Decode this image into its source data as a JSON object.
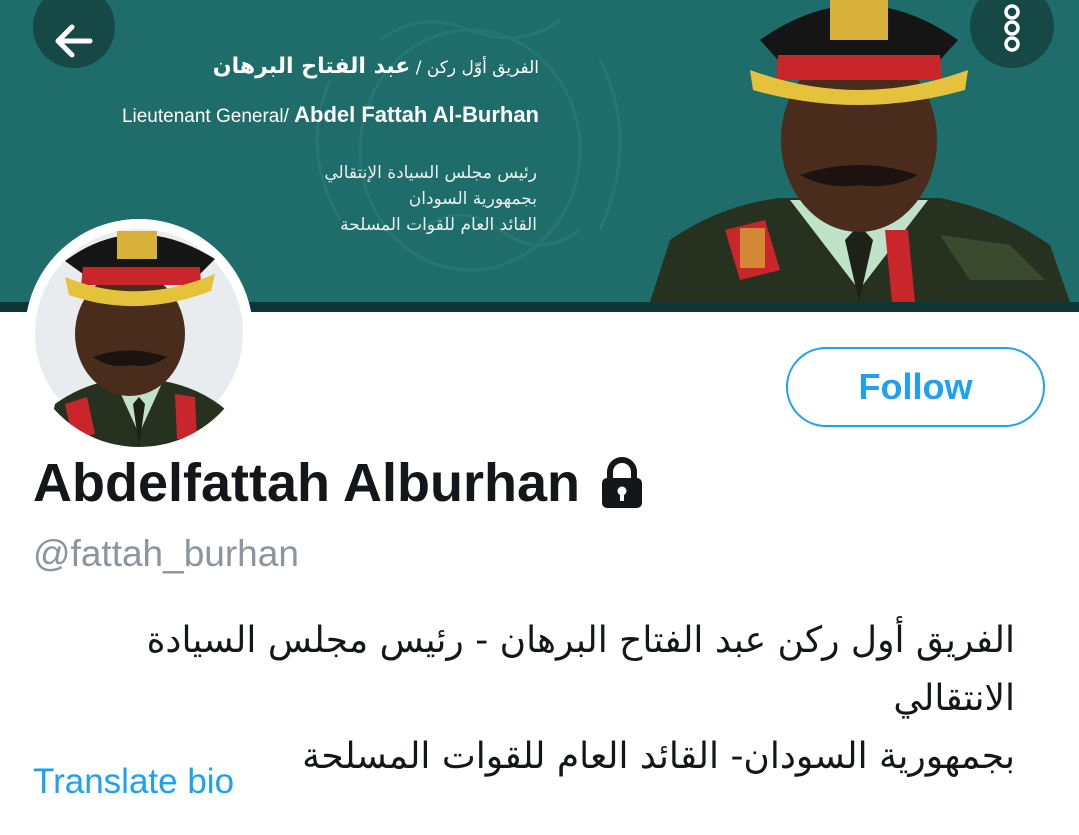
{
  "header": {
    "back_icon": "arrow-left-icon",
    "more_icon": "vertical-dots-icon",
    "colors": {
      "banner": "#1e6d6b",
      "strip": "#0f3535"
    }
  },
  "banner": {
    "ar_title_prefix": "الفريق أوّل ركن /",
    "ar_name": "عبد الفتاح البرهان",
    "en_title_prefix": "Lieutenant General/",
    "en_name": "Abdel Fattah Al-Burhan",
    "ar_roles": [
      "رئيس مجلس السيادة الإنتقالي",
      "بجمهورية السودان",
      "القائد العام للقوات المسلحة"
    ]
  },
  "profile": {
    "display_name": "Abdelfattah Alburhan",
    "lock_icon": "lock-icon",
    "handle": "@fattah_burhan",
    "bio_lines": [
      "الفريق أول ركن عبد الفتاح البرهان - رئيس مجلس السيادة الانتقالي",
      "بجمهورية السودان- القائد العام للقوات المسلحة"
    ],
    "translate_label": "Translate bio",
    "follow_label": "Follow",
    "colors": {
      "accent": "#1da1f2",
      "text": "#14171a",
      "muted": "#8a959e"
    }
  }
}
